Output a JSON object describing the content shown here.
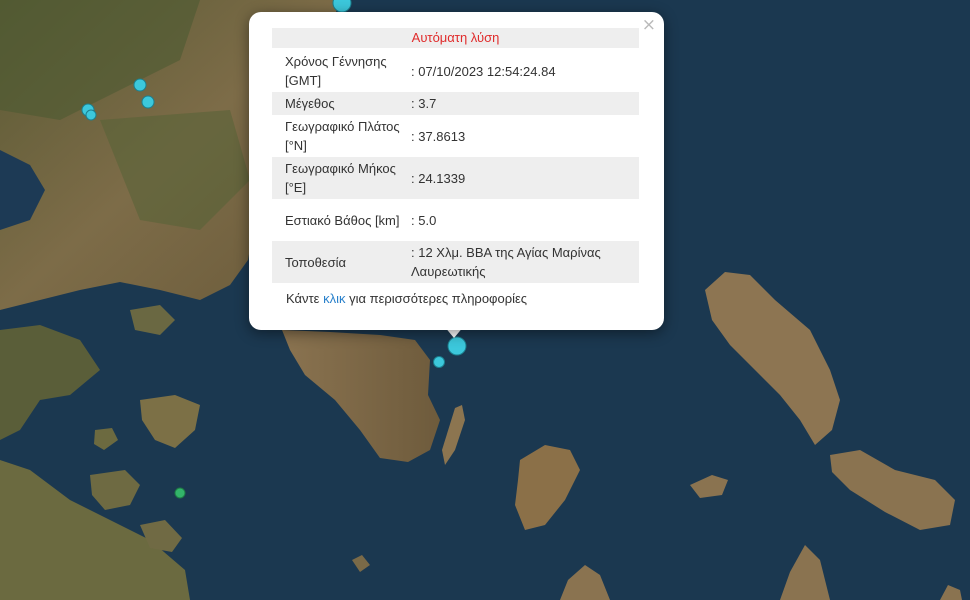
{
  "popup": {
    "title": "Αυτόματη λύση",
    "close_icon": "×",
    "rows": [
      {
        "label": "Χρόνος Γέννησης [GMT]",
        "value": ": 07/10/2023 12:54:24.84"
      },
      {
        "label": "Μέγεθος",
        "value": ": 3.7"
      },
      {
        "label": "Γεωγραφικό Πλάτος [°N]",
        "value": ": 37.8613"
      },
      {
        "label": "Γεωγραφικό Μήκος [°E]",
        "value": ": 24.1339"
      },
      {
        "label": "Εστιακό Βάθος [km]",
        "value": ": 5.0"
      },
      {
        "label": "Τοποθεσία",
        "value": ": 12 Χλμ. ΒΒΑ της Αγίας Μαρίνας Λαυρεωτικής"
      }
    ],
    "more_before": "Κάντε ",
    "more_link": "κλικ",
    "more_after": " για περισσότερες πληροφορίες"
  },
  "colors": {
    "sea": "#1b3850",
    "land": "#7a6a48",
    "marker_cyan": "#3cc8dc",
    "marker_green": "#33b46a",
    "title_red": "#e02b2b",
    "link_blue": "#2a81cb"
  },
  "markers": [
    {
      "type": "earthquake",
      "color": "cyan"
    },
    {
      "type": "earthquake",
      "color": "cyan"
    },
    {
      "type": "earthquake",
      "color": "cyan"
    },
    {
      "type": "earthquake",
      "color": "cyan"
    },
    {
      "type": "earthquake",
      "color": "cyan"
    },
    {
      "type": "earthquake-selected",
      "color": "cyan"
    },
    {
      "type": "earthquake",
      "color": "cyan"
    },
    {
      "type": "earthquake",
      "color": "green"
    }
  ]
}
